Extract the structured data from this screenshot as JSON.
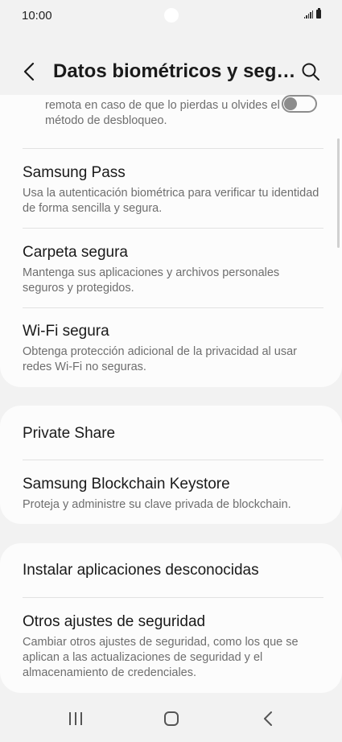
{
  "status_bar": {
    "time": "10:00",
    "icons": [
      "signal-icon",
      "battery-icon"
    ]
  },
  "header": {
    "title": "Datos biométricos y seg…",
    "back_icon": "chevron-left-icon",
    "search_icon": "search-icon"
  },
  "sections": [
    {
      "items": [
        {
          "title": "",
          "description": "Localiza y controla tu teléfono de forma remota en caso de que lo pierdas u olvides el método de desbloqueo.",
          "visible_description": "remota en caso de que lo pierdas u olvides el método de desbloqueo.",
          "toggle": "off"
        },
        {
          "title": "Samsung Pass",
          "description": "Usa la autenticación biométrica para verificar tu identidad de forma sencilla y segura."
        },
        {
          "title": "Carpeta segura",
          "description": "Mantenga sus aplicaciones y archivos personales seguros y protegidos."
        },
        {
          "title": "Wi-Fi segura",
          "description": "Obtenga protección adicional de la privacidad al usar redes Wi-Fi no seguras."
        }
      ]
    },
    {
      "items": [
        {
          "title": "Private Share",
          "description": ""
        },
        {
          "title": "Samsung Blockchain Keystore",
          "description": "Proteja y administre su clave privada de blockchain."
        }
      ]
    },
    {
      "items": [
        {
          "title": "Instalar aplicaciones desconocidas",
          "description": ""
        },
        {
          "title": "Otros ajustes de seguridad",
          "description": "Cambiar otros ajustes de seguridad, como los que se aplican a las actualizaciones de seguridad y el almacenamiento de credenciales."
        }
      ]
    }
  ],
  "nav_bar": {
    "icons": [
      "recent-apps-icon",
      "home-icon",
      "back-icon"
    ]
  },
  "colors": {
    "background": "#f2f2f2",
    "card": "#fcfcfc",
    "text_primary": "#1a1a1a",
    "text_secondary": "#6e6e6e"
  }
}
